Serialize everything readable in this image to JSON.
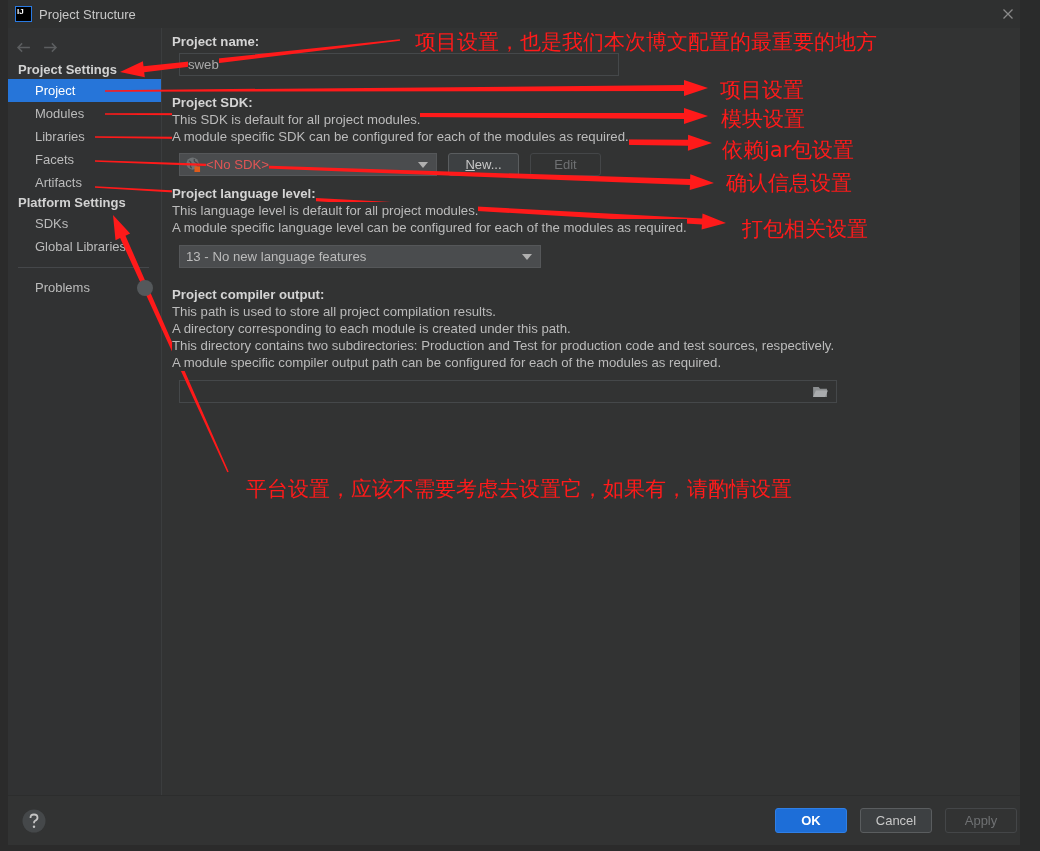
{
  "window": {
    "logo": "IJ",
    "title": "Project Structure"
  },
  "sidebar": {
    "sections": [
      {
        "heading": "Project Settings",
        "items": [
          {
            "label": "Project",
            "selected": true
          },
          {
            "label": "Modules",
            "selected": false
          },
          {
            "label": "Libraries",
            "selected": false
          },
          {
            "label": "Facets",
            "selected": false
          },
          {
            "label": "Artifacts",
            "selected": false
          }
        ]
      },
      {
        "heading": "Platform Settings",
        "items": [
          {
            "label": "SDKs",
            "selected": false
          },
          {
            "label": "Global Libraries",
            "selected": false
          }
        ]
      }
    ],
    "problems": {
      "label": "Problems",
      "selected": false
    }
  },
  "project_name": {
    "label": "Project name:",
    "value": "sweb"
  },
  "project_sdk": {
    "label": "Project SDK:",
    "description": [
      "This SDK is default for all project modules.",
      "A module specific SDK can be configured for each of the modules as required."
    ],
    "dropdown": {
      "value": "<No SDK>",
      "invalid": true
    },
    "buttons": [
      {
        "label": "New...",
        "mnemonic": true,
        "disabled": false
      },
      {
        "label": "Edit",
        "mnemonic": false,
        "disabled": true
      }
    ]
  },
  "language_level": {
    "label": "Project language level:",
    "description": [
      "This language level is default for all project modules.",
      "A module specific language level can be configured for each of the modules as required."
    ],
    "dropdown": {
      "value": "13 - No new language features"
    }
  },
  "compiler_output": {
    "label": "Project compiler output:",
    "description": [
      "This path is used to store all project compilation results.",
      "A directory corresponding to each module is created under this path.",
      "This directory contains two subdirectories: Production and Test for production code and test sources, respectively.",
      "A module specific compiler output path can be configured for each of the modules as required."
    ]
  },
  "footer": {
    "buttons": [
      {
        "label": "OK",
        "kind": "primary",
        "disabled": false
      },
      {
        "label": "Cancel",
        "kind": "normal",
        "disabled": false
      },
      {
        "label": "Apply",
        "kind": "normal",
        "disabled": true
      }
    ]
  },
  "annotations": [
    {
      "text": "项目设置，也是我们本次博文配置的最重要的地方"
    },
    {
      "text": "项目设置"
    },
    {
      "text": "模块设置"
    },
    {
      "text": "依赖jar包设置"
    },
    {
      "text": "确认信息设置"
    },
    {
      "text": "打包相关设置"
    },
    {
      "text": "平台设置，应该不需要考虑去设置它，如果有，请酌情设置"
    }
  ]
}
